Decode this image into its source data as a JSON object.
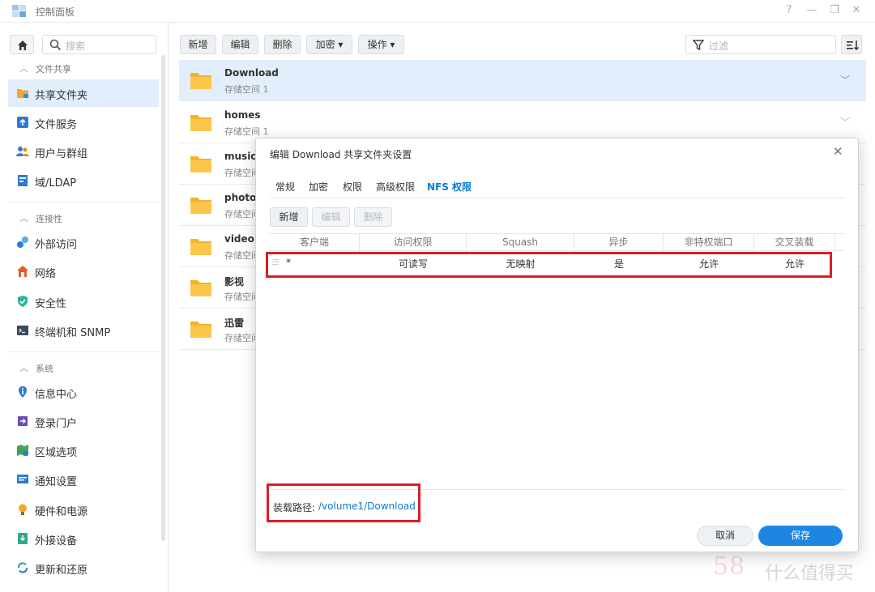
{
  "window": {
    "title": "控制面板",
    "controls": [
      "?",
      "—",
      "❐",
      "✕"
    ]
  },
  "sidebar": {
    "search_placeholder": "搜索",
    "groups": [
      {
        "label": "文件共享",
        "items": [
          {
            "label": "共享文件夹",
            "icon": "folder-share-icon",
            "active": true
          },
          {
            "label": "文件服务",
            "icon": "file-services-icon"
          },
          {
            "label": "用户与群组",
            "icon": "users-groups-icon"
          },
          {
            "label": "域/LDAP",
            "icon": "domain-ldap-icon"
          }
        ]
      },
      {
        "label": "连接性",
        "items": [
          {
            "label": "外部访问",
            "icon": "external-access-icon"
          },
          {
            "label": "网络",
            "icon": "network-icon"
          },
          {
            "label": "安全性",
            "icon": "security-shield-icon"
          },
          {
            "label": "终端机和 SNMP",
            "icon": "terminal-icon"
          }
        ]
      },
      {
        "label": "系统",
        "items": [
          {
            "label": "信息中心",
            "icon": "info-center-icon"
          },
          {
            "label": "登录门户",
            "icon": "login-portal-icon"
          },
          {
            "label": "区域选项",
            "icon": "regional-options-icon"
          },
          {
            "label": "通知设置",
            "icon": "notification-icon"
          },
          {
            "label": "硬件和电源",
            "icon": "hardware-power-icon"
          },
          {
            "label": "外接设备",
            "icon": "external-devices-icon"
          },
          {
            "label": "更新和还原",
            "icon": "update-restore-icon"
          }
        ]
      }
    ]
  },
  "toolbar": {
    "create": "新增",
    "edit": "编辑",
    "delete": "删除",
    "encrypt": "加密 ▾",
    "action": "操作 ▾",
    "filter_placeholder": "过滤"
  },
  "folders": [
    {
      "name": "Download",
      "sub": "存储空间 1",
      "selected": true
    },
    {
      "name": "homes",
      "sub": "存储空间 1"
    },
    {
      "name": "music",
      "sub": "存储空间"
    },
    {
      "name": "photo",
      "sub": "存储空间"
    },
    {
      "name": "video",
      "sub": "存储空间"
    },
    {
      "name": "影视",
      "sub": "存储空间"
    },
    {
      "name": "迅雷",
      "sub": "存储空间"
    }
  ],
  "dialog": {
    "title": "编辑 Download 共享文件夹设置",
    "tabs": [
      "常规",
      "加密",
      "权限",
      "高级权限",
      "NFS 权限"
    ],
    "active_tab": "NFS 权限",
    "buttons": {
      "create": "新增",
      "edit": "编辑",
      "delete": "删除"
    },
    "columns": [
      "客户端",
      "访问权限",
      "Squash",
      "异步",
      "非特权端口",
      "交叉装载"
    ],
    "rows": [
      {
        "client": "*",
        "access": "可读写",
        "squash": "无映射",
        "async": "是",
        "nonpriv": "允许",
        "crossmnt": "允许"
      }
    ],
    "mount_label": "装载路径:",
    "mount_path": "/volume1/Download",
    "cancel": "取消",
    "save": "保存",
    "highlight_color": "#d81e28"
  },
  "watermark": {
    "brand": "58",
    "text": "什么值得买"
  },
  "colors": {
    "accent": "#1d86e3",
    "selected_row": "#e2eefb",
    "link": "#0a7bd1"
  }
}
